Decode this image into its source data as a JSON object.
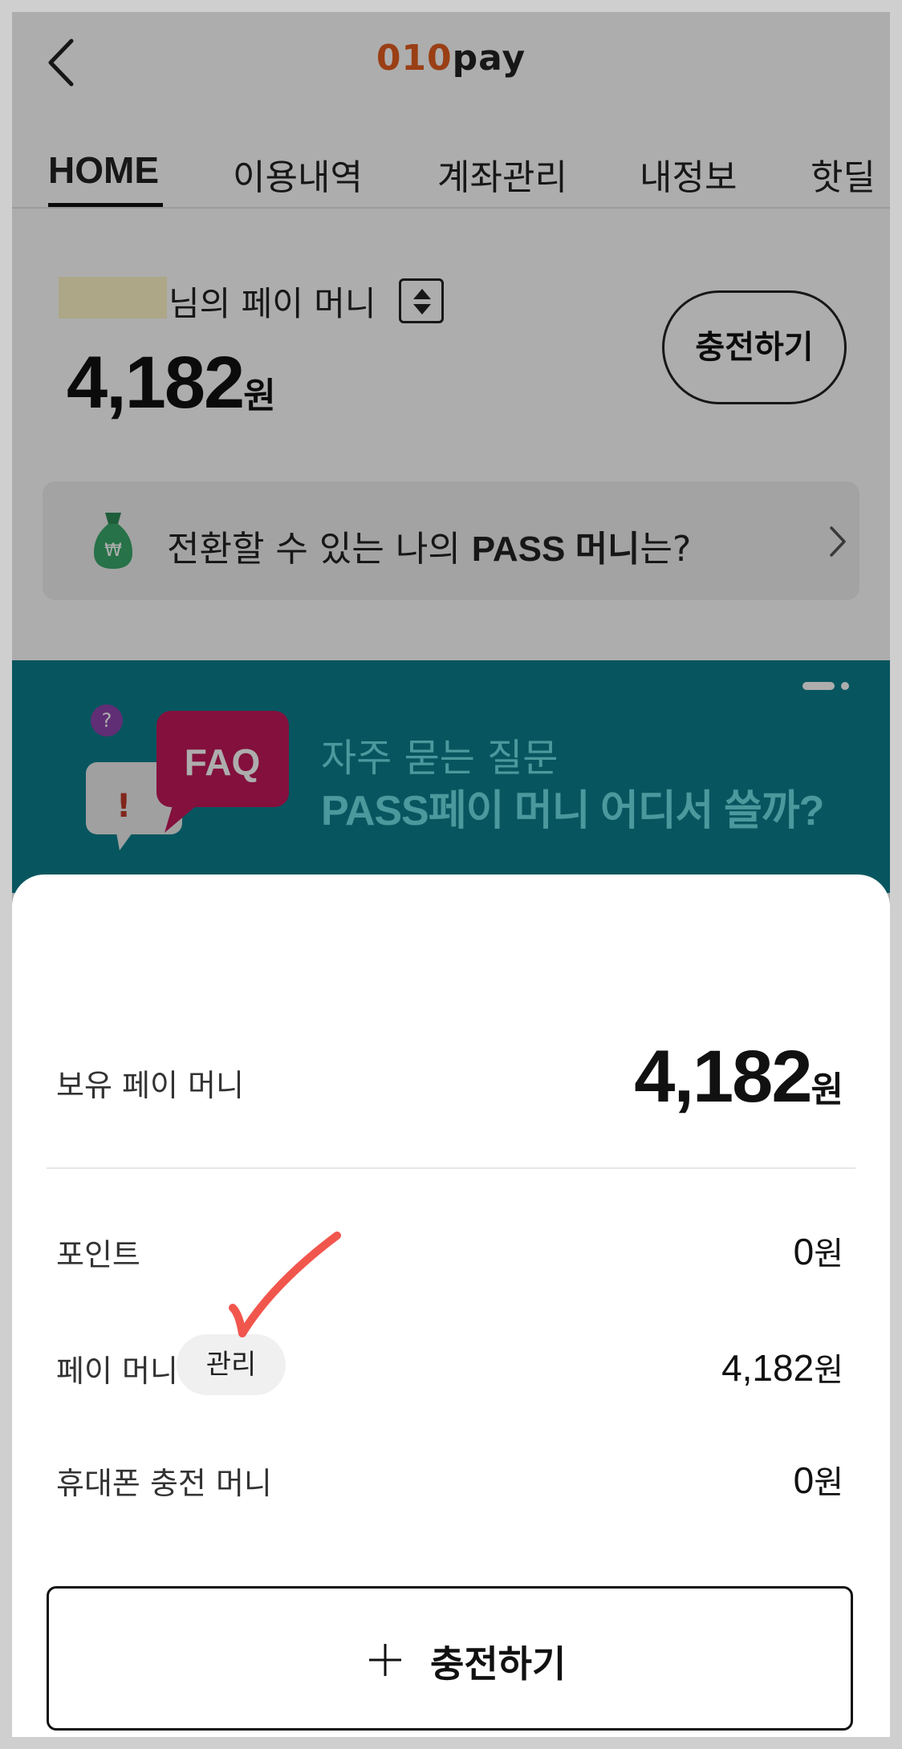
{
  "header": {
    "logo_number": "010",
    "logo_text": "pay"
  },
  "tabs": [
    {
      "label": "HOME",
      "active": true
    },
    {
      "label": "이용내역"
    },
    {
      "label": "계좌관리"
    },
    {
      "label": "내정보"
    },
    {
      "label": "핫딜"
    }
  ],
  "balance": {
    "greeting_suffix": "님의 페이 머니",
    "amount": "4,182",
    "unit": "원",
    "charge_label": "충전하기"
  },
  "pass_banner": {
    "text_prefix": "전환할 수 있는 나의 ",
    "text_bold": "PASS 머니",
    "text_suffix": "는?",
    "bag_symbol": "₩"
  },
  "faq_banner": {
    "badge": "FAQ",
    "subtitle": "자주 묻는 질문",
    "title": "PASS페이 머니 어디서 쓸까?",
    "color": "#0b7f8c"
  },
  "sheet": {
    "held": {
      "label": "보유 페이 머니",
      "amount": "4,182",
      "unit": "원"
    },
    "rows": [
      {
        "label": "포인트",
        "amount": "0",
        "unit": "원"
      },
      {
        "label": "페이 머니",
        "chip": "관리",
        "amount": "4,182",
        "unit": "원"
      },
      {
        "label": "휴대폰 충전 머니",
        "amount": "0",
        "unit": "원"
      }
    ],
    "charge_button": "충전하기"
  },
  "colors": {
    "brand_orange": "#e35e1f",
    "faq_teal": "#0b7f8c",
    "annotation_red": "#f0443a"
  }
}
